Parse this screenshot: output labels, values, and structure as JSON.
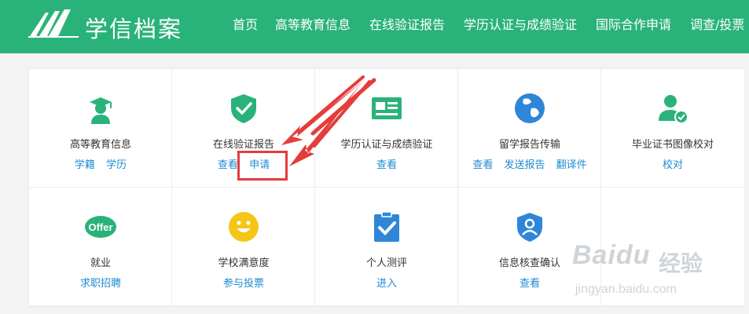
{
  "header": {
    "logo_text": "学信档案",
    "nav": [
      "首页",
      "高等教育信息",
      "在线验证报告",
      "学历认证与成绩验证",
      "国际合作申请",
      "调查/投票"
    ]
  },
  "services": [
    {
      "title": "高等教育信息",
      "icon": "graduate-icon",
      "links": [
        "学籍",
        "学历"
      ]
    },
    {
      "title": "在线验证报告",
      "icon": "shield-check-icon",
      "links": [
        "查看",
        "申请"
      ]
    },
    {
      "title": "学历认证与成绩验证",
      "icon": "id-card-icon",
      "links": [
        "查看"
      ]
    },
    {
      "title": "留学报告传输",
      "icon": "globe-icon",
      "links": [
        "查看",
        "发送报告",
        "翻译件"
      ]
    },
    {
      "title": "毕业证书图像校对",
      "icon": "user-check-icon",
      "links": [
        "校对"
      ]
    },
    {
      "title": "就业",
      "icon": "offer-icon",
      "icon_text": "Offer",
      "links": [
        "求职招聘"
      ]
    },
    {
      "title": "学校满意度",
      "icon": "smiley-icon",
      "links": [
        "参与投票"
      ]
    },
    {
      "title": "个人测评",
      "icon": "clipboard-check-icon",
      "links": [
        "进入"
      ]
    },
    {
      "title": "信息核查确认",
      "icon": "shield-user-icon",
      "links": [
        "查看"
      ]
    }
  ],
  "watermark": {
    "brand": "Baidu",
    "sub": "经验",
    "url": "jingyan.baidu.com"
  },
  "colors": {
    "header": "#2ab27b",
    "link": "#1d8bd1",
    "annotation": "#e53c3c"
  }
}
